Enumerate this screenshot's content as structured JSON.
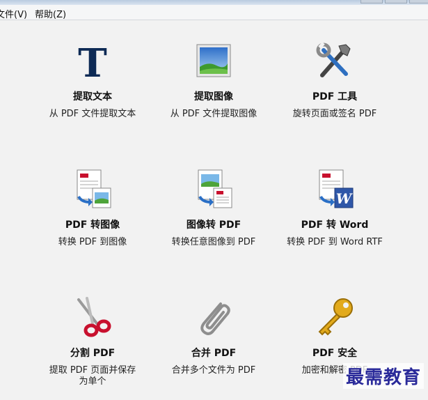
{
  "menu": {
    "file": "文件(V)",
    "help": "帮助(Z)"
  },
  "tiles": [
    {
      "title": "提取文本",
      "desc": "从 PDF 文件提取文本",
      "icon": "text-t-icon"
    },
    {
      "title": "提取图像",
      "desc": "从 PDF 文件提取图像",
      "icon": "picture-icon"
    },
    {
      "title": "PDF 工具",
      "desc": "旋转页面或签名 PDF",
      "icon": "tools-icon"
    },
    {
      "title": "PDF 转图像",
      "desc": "转换 PDF 到图像",
      "icon": "pdf-to-image-icon"
    },
    {
      "title": "图像转 PDF",
      "desc": "转换任意图像到 PDF",
      "icon": "image-to-pdf-icon"
    },
    {
      "title": "PDF 转 Word",
      "desc": "转换 PDF 到 Word RTF",
      "icon": "pdf-to-word-icon"
    },
    {
      "title": "分割 PDF",
      "desc": "提取 PDF 页面并保存为单个",
      "icon": "scissors-icon"
    },
    {
      "title": "合并 PDF",
      "desc": "合并多个文件为 PDF",
      "icon": "paperclip-icon"
    },
    {
      "title": "PDF 安全",
      "desc": "加密和解密 PDF",
      "icon": "key-icon"
    }
  ],
  "watermark": "最需教育",
  "colors": {
    "background": "#f2f2f2",
    "menubar": "#f5f6f7",
    "title_strip": "#b9cbe0",
    "watermark": "#2a2a9a",
    "word_blue": "#2f57a8",
    "key_gold": "#e2aa1c",
    "scissors_red": "#c8102e"
  }
}
